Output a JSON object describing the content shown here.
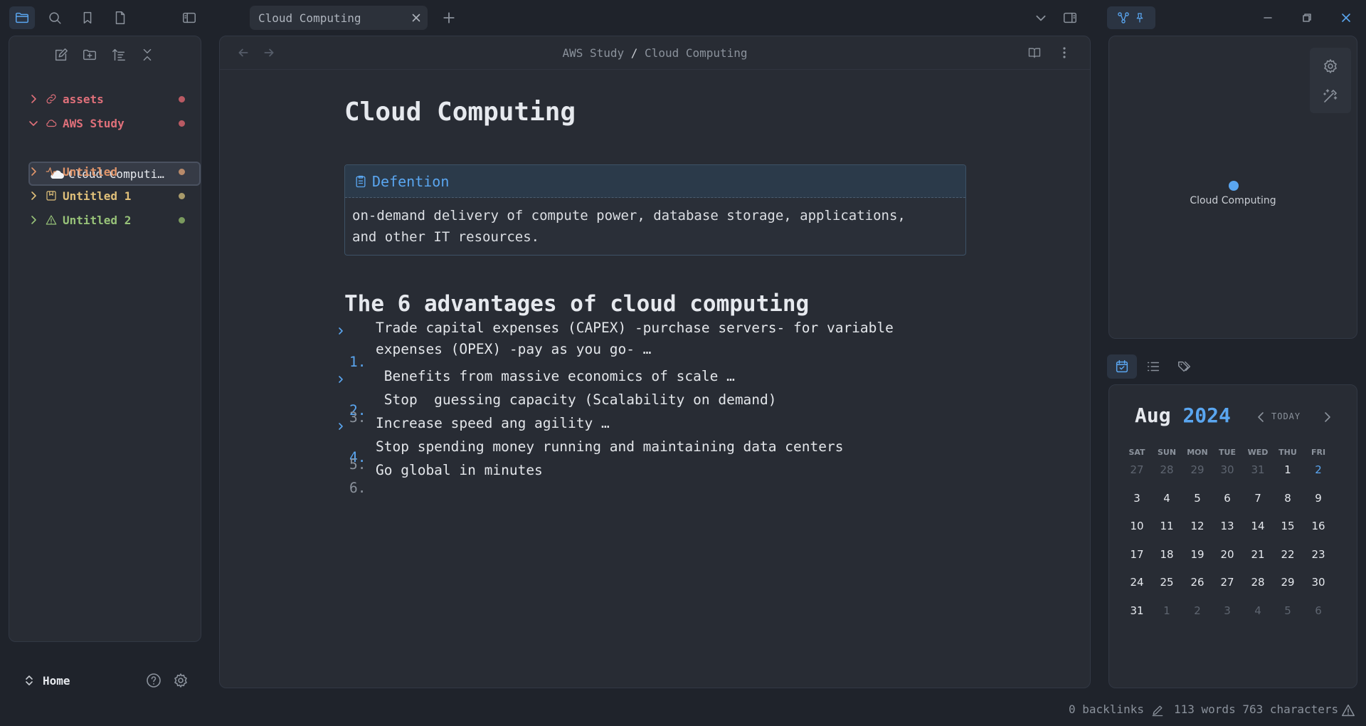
{
  "tab": {
    "title": "Cloud Computing"
  },
  "breadcrumb": {
    "folder": "AWS Study",
    "sep": " / ",
    "file": "Cloud Computing"
  },
  "sidebar": {
    "items": [
      {
        "label": "assets",
        "color": "#e0707a",
        "dot": "#b95a63",
        "expanded": false,
        "icon": "link-icon"
      },
      {
        "label": "AWS Study",
        "color": "#e0707a",
        "dot": "#b95a63",
        "expanded": true,
        "icon": "cloud-icon"
      },
      {
        "label": "Untitled",
        "color": "#e0956a",
        "dot": "#b88a6a",
        "expanded": false,
        "icon": "activity-icon"
      },
      {
        "label": "Untitled 1",
        "color": "#e0c07a",
        "dot": "#a89a6a",
        "expanded": false,
        "icon": "bookmark-square-icon"
      },
      {
        "label": "Untitled 2",
        "color": "#98c379",
        "dot": "#7a9a5e",
        "expanded": false,
        "icon": "warning-icon"
      }
    ],
    "active_file": "Cloud Computi…",
    "home": "Home"
  },
  "doc": {
    "title": "Cloud Computing",
    "callout": {
      "title": "Defention",
      "body_line1": "on-demand delivery of compute power, database storage, applications,",
      "body_line2": "and other IT resources."
    },
    "heading": "The 6 advantages of cloud computing",
    "list": [
      {
        "num": "1.",
        "line1": "Trade capital expenses (CAPEX) -purchase servers- for variable",
        "line2": "expenses (OPEX) -pay as you go- …",
        "folded": true
      },
      {
        "num": "2.",
        "line1": " Benefits from massive economics of scale …",
        "folded": true
      },
      {
        "num": "3.",
        "line1": " Stop  guessing capacity (Scalability on demand)",
        "folded": false
      },
      {
        "num": "4.",
        "line1": "Increase speed ang agility …",
        "folded": true
      },
      {
        "num": "5.",
        "line1": "Stop spending money running and maintaining data centers",
        "folded": false
      },
      {
        "num": "6.",
        "line1": "Go global in minutes",
        "folded": false
      }
    ]
  },
  "graph": {
    "node_label": "Cloud Computing",
    "node_color": "#5aa6f0"
  },
  "calendar": {
    "month": "Aug",
    "year": "2024",
    "today_label": "TODAY",
    "days_of_week": [
      "SAT",
      "SUN",
      "MON",
      "TUE",
      "WED",
      "THU",
      "FRI"
    ],
    "weeks": [
      [
        "27",
        "28",
        "29",
        "30",
        "31",
        "1",
        "2"
      ],
      [
        "3",
        "4",
        "5",
        "6",
        "7",
        "8",
        "9"
      ],
      [
        "10",
        "11",
        "12",
        "13",
        "14",
        "15",
        "16"
      ],
      [
        "17",
        "18",
        "19",
        "20",
        "21",
        "22",
        "23"
      ],
      [
        "24",
        "25",
        "26",
        "27",
        "28",
        "29",
        "30"
      ],
      [
        "31",
        "1",
        "2",
        "3",
        "4",
        "5",
        "6"
      ]
    ],
    "highlighted_day": "2"
  },
  "status": {
    "backlinks": "0 backlinks",
    "counts": "113 words 763 characters"
  }
}
